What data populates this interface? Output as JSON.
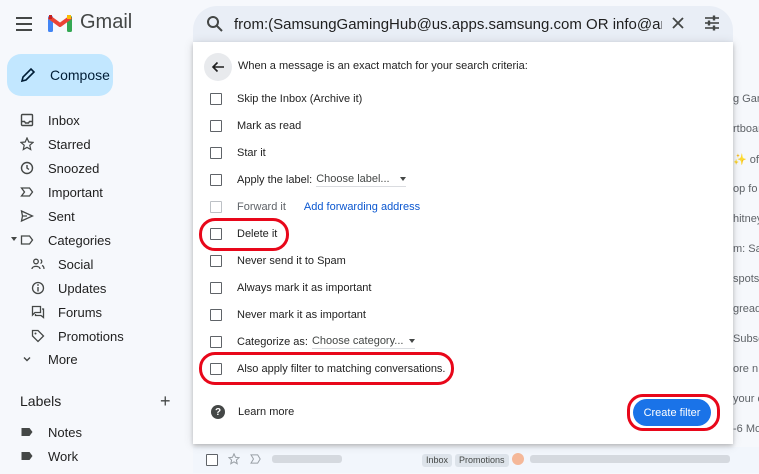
{
  "header": {
    "logo_text": "Gmail",
    "search_value": "from:(SamsungGamingHub@us.apps.samsung.com OR info@artboard.studio C"
  },
  "sidebar": {
    "compose_label": "Compose",
    "items": [
      {
        "label": "Inbox",
        "icon": "inbox-icon"
      },
      {
        "label": "Starred",
        "icon": "star-icon"
      },
      {
        "label": "Snoozed",
        "icon": "clock-icon"
      },
      {
        "label": "Important",
        "icon": "important-icon"
      },
      {
        "label": "Sent",
        "icon": "send-icon"
      },
      {
        "label": "Categories",
        "icon": "label-outline-icon"
      },
      {
        "label": "Social",
        "icon": "people-icon"
      },
      {
        "label": "Updates",
        "icon": "info-icon"
      },
      {
        "label": "Forums",
        "icon": "forum-icon"
      },
      {
        "label": "Promotions",
        "icon": "tag-icon"
      },
      {
        "label": "More",
        "icon": "chevron-down-icon"
      }
    ],
    "labels_heading": "Labels",
    "labels": [
      {
        "label": "Notes",
        "icon": "label-icon"
      },
      {
        "label": "Work",
        "icon": "label-icon"
      }
    ]
  },
  "filter": {
    "criteria_text": "When a message is an exact match for your search criteria:",
    "options": {
      "skip_inbox": "Skip the Inbox (Archive it)",
      "mark_read": "Mark as read",
      "star": "Star it",
      "apply_label": "Apply the label:",
      "label_dropdown": "Choose label...",
      "forward": "Forward it",
      "forward_link": "Add forwarding address",
      "delete": "Delete it",
      "never_spam": "Never send it to Spam",
      "always_important": "Always mark it as important",
      "never_important": "Never mark it as important",
      "categorize": "Categorize as:",
      "category_dropdown": "Choose category...",
      "also_apply": "Also apply filter to matching conversations."
    },
    "learn_more": "Learn more",
    "create_button": "Create filter"
  },
  "background_list": {
    "snippets": [
      "g Gam",
      "rtboar",
      "✨ of",
      "op fo",
      "hitney",
      "m: Sa",
      "spots",
      "gread",
      "Subscri",
      "ore n",
      "your c",
      "-6 Mo"
    ],
    "chips": [
      "Inbox",
      "Promotions"
    ]
  },
  "colors": {
    "accent": "#1a73e8",
    "compose_bg": "#c2e7ff",
    "highlight": "#e8071a"
  }
}
